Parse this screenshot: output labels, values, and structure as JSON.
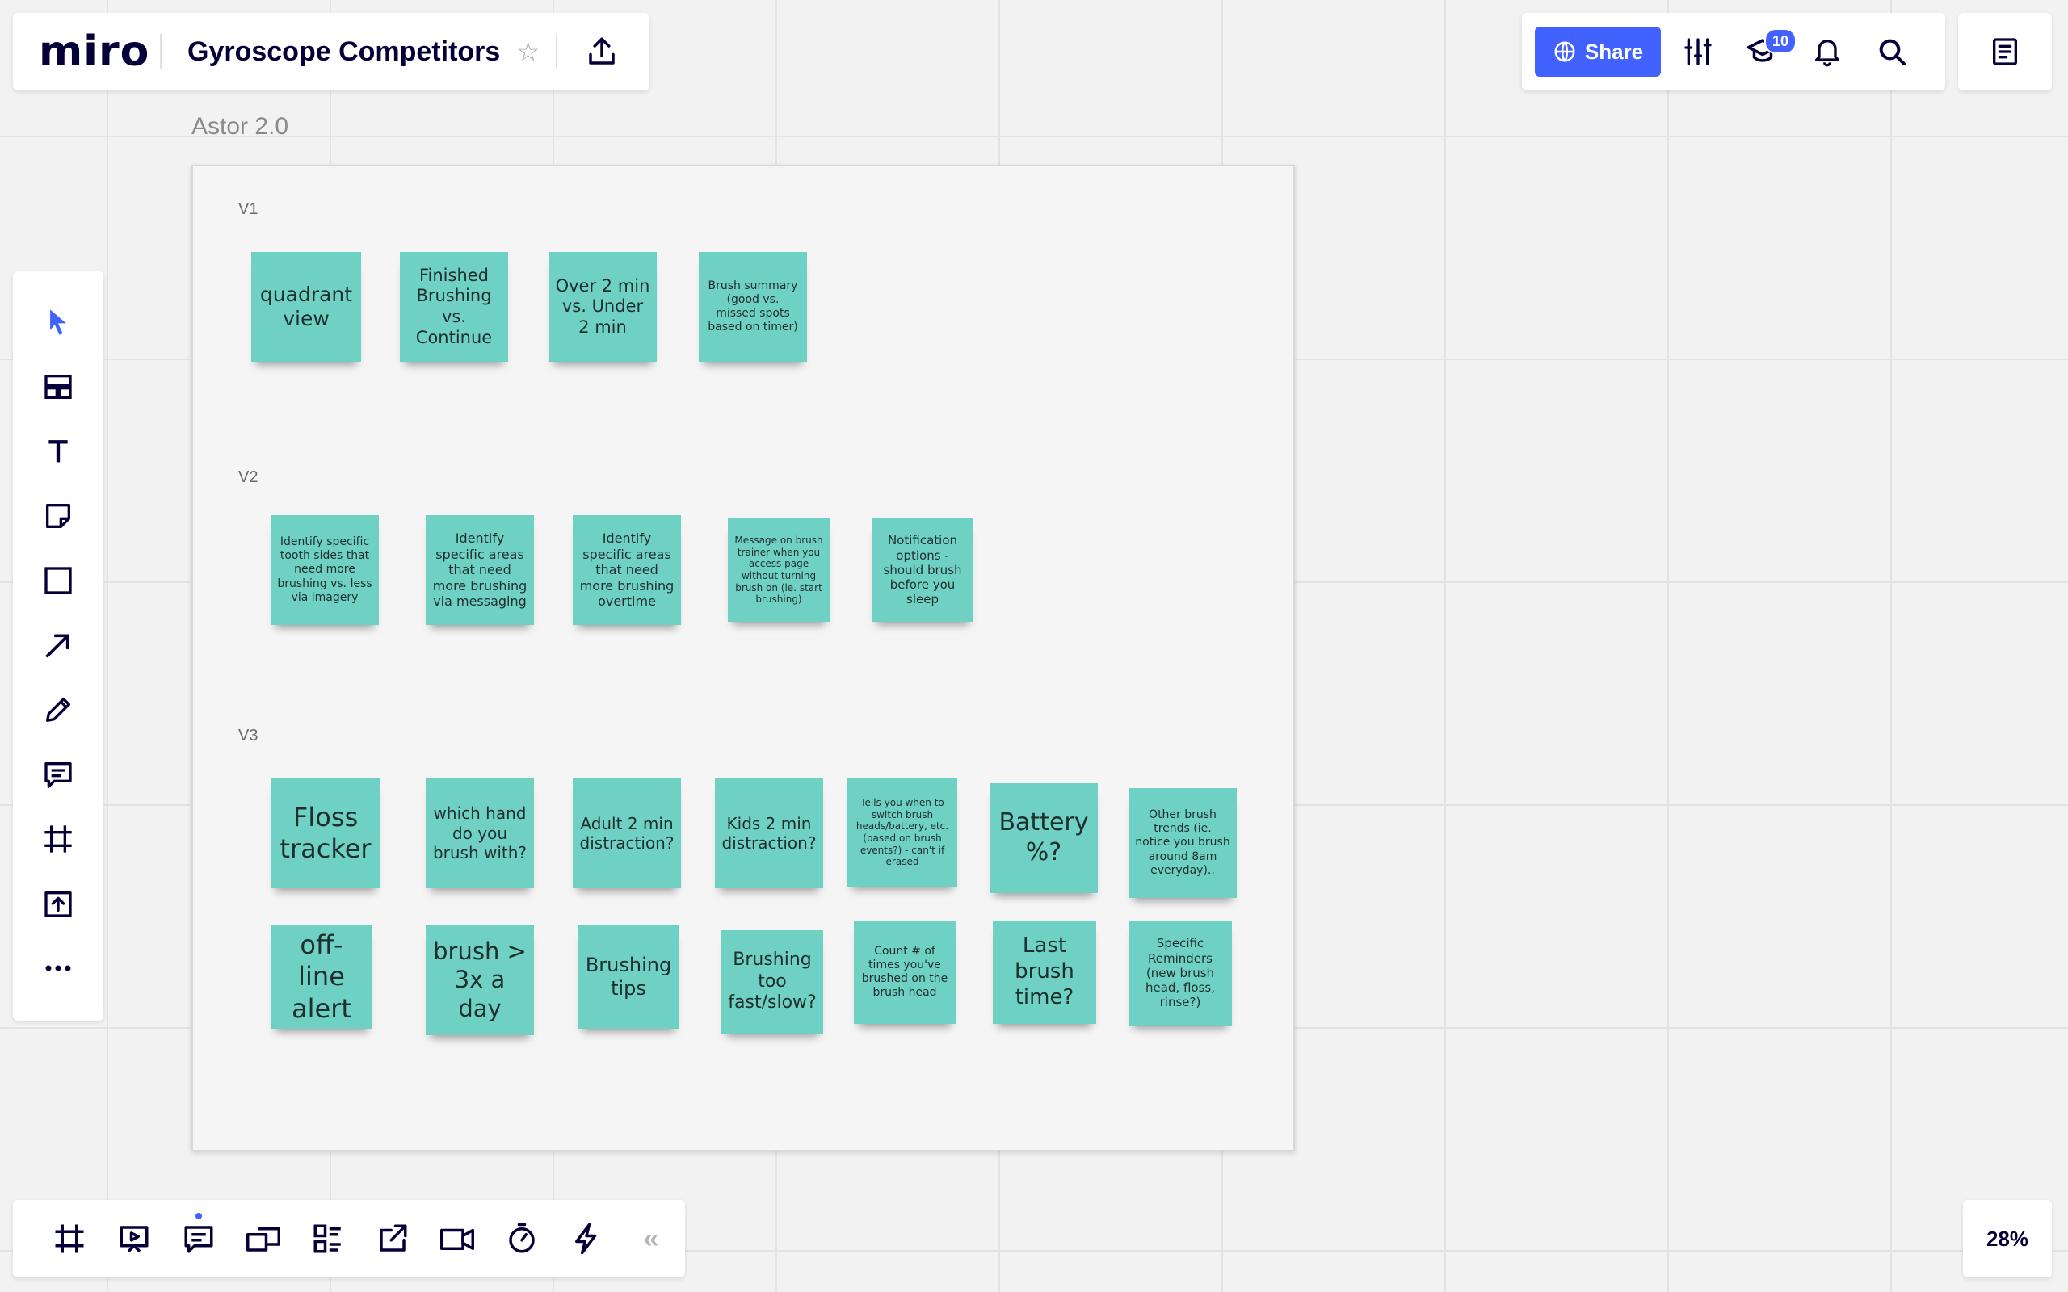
{
  "header": {
    "logo": "miro",
    "board_title": "Gyroscope Competitors",
    "share_label": "Share",
    "learning_badge": "10"
  },
  "frame": {
    "title": "Astor 2.0"
  },
  "sections": [
    {
      "label": "V1",
      "stickies": [
        "quadrant view",
        "Finished Brushing vs. Continue",
        "Over 2 min vs. Under 2 min",
        "Brush summary (good vs. missed spots based on timer)"
      ]
    },
    {
      "label": "V2",
      "stickies": [
        "Identify specific tooth sides that need more brushing vs. less via  imagery",
        "Identify specific areas that need more brushing via messaging",
        "Identify specific areas that need more brushing overtime",
        "Message on brush trainer when you access page without turning brush on (ie. start brushing)",
        "Notification options - should brush before you sleep"
      ]
    },
    {
      "label": "V3",
      "stickies": [
        "Floss tracker",
        "which hand do you brush with?",
        "Adult 2 min distraction?",
        "Kids 2 min distraction?",
        "Tells you when to switch brush heads/battery, etc.(based on brush events?) - can't if erased",
        "Battery %?",
        "Other brush trends (ie. notice you brush around 8am everyday)..",
        "off-line alert",
        "brush > 3x a day",
        "Brushing tips",
        "Brushing too fast/slow?",
        "Count  # of times you've brushed on the brush head",
        "Last brush time?",
        "Specific Reminders (new brush head, floss, rinse?)"
      ]
    }
  ],
  "zoom": "28%",
  "colors": {
    "accent": "#4262ff",
    "sticky": "#6fd0c4",
    "ink": "#050038"
  },
  "left_toolbar": [
    "select-icon",
    "templates-icon",
    "text-icon",
    "sticky-note-icon",
    "shape-icon",
    "arrow-icon",
    "pen-icon",
    "comment-icon",
    "frame-icon",
    "upload-icon",
    "more-icon"
  ],
  "bottom_toolbar": [
    "frames-icon",
    "presentation-icon",
    "comments-icon",
    "screen-share-icon",
    "card-list-icon",
    "export-icon",
    "video-icon",
    "timer-icon",
    "lightning-icon"
  ]
}
